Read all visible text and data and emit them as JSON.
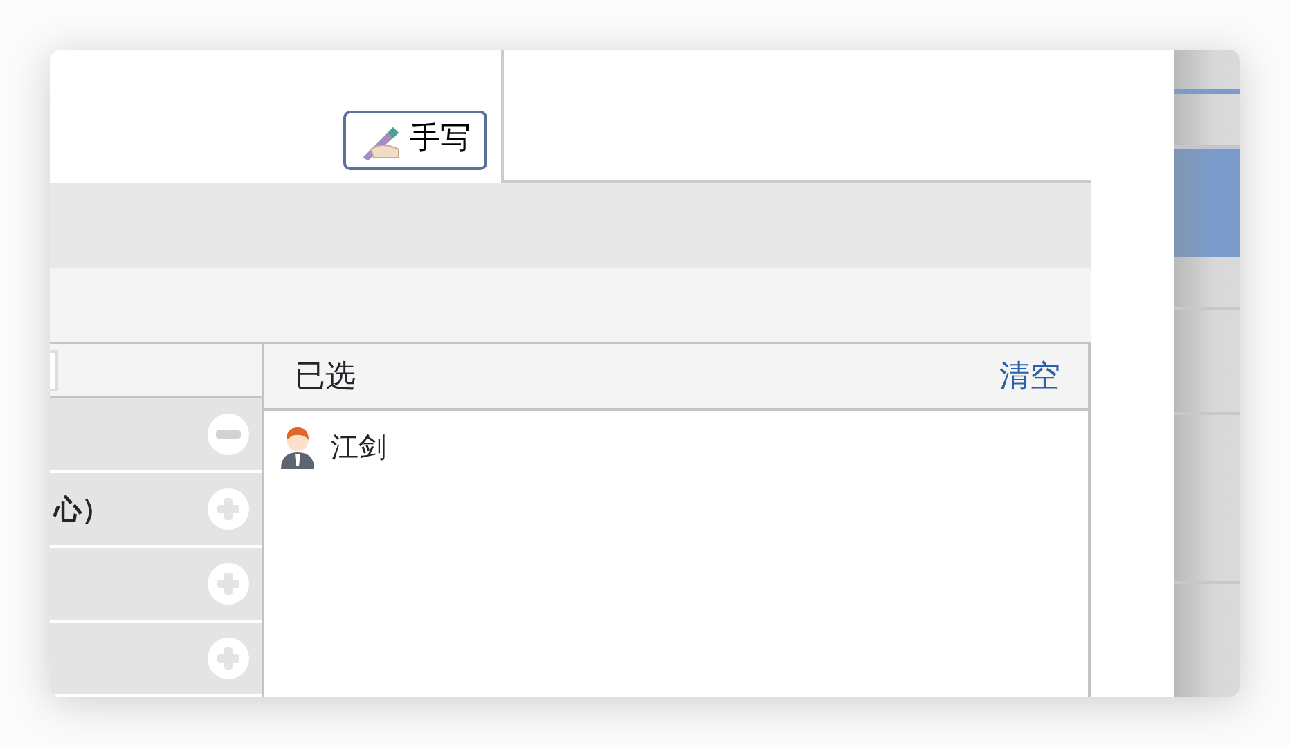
{
  "handwrite_button": {
    "label": "手写"
  },
  "candidates": [
    {
      "selected": true
    },
    {
      "label": "心）",
      "selected": false
    },
    {
      "selected": false
    },
    {
      "selected": false
    }
  ],
  "selected_panel": {
    "title": "已选",
    "clear_link": "清空",
    "items": [
      {
        "name": "江剑"
      }
    ]
  }
}
